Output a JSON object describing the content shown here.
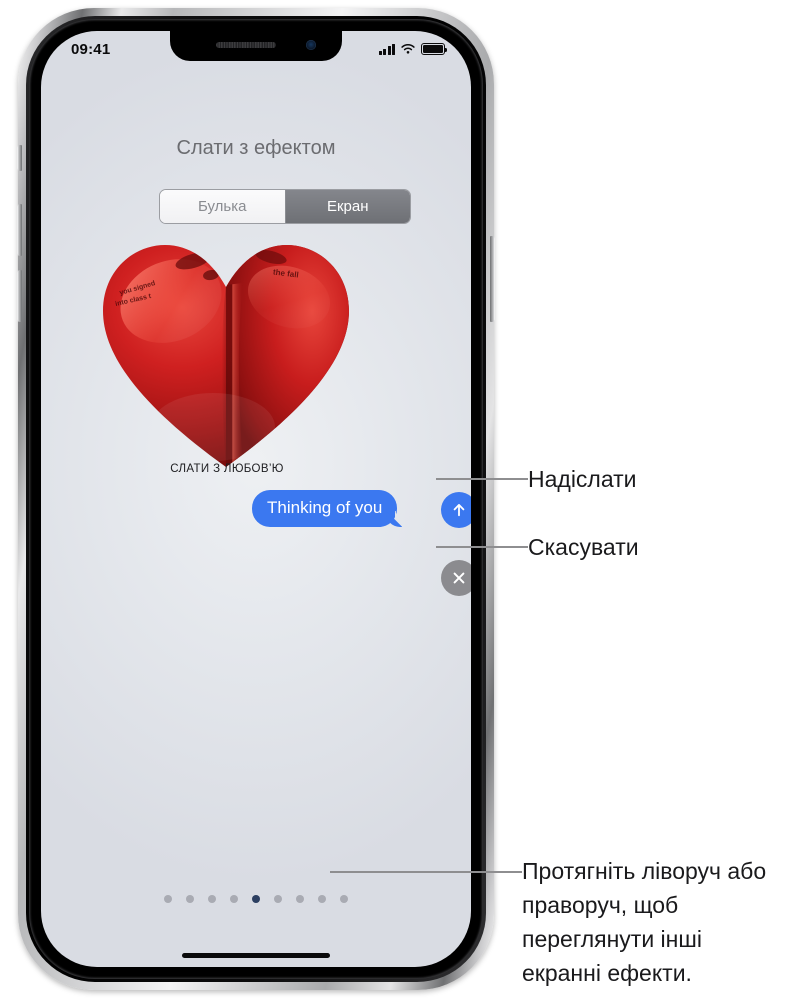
{
  "device": {
    "name": "iphone-x",
    "hardware_buttons": [
      "silent-switch",
      "volume-up",
      "volume-down",
      "side-button"
    ]
  },
  "statusbar": {
    "time": "09:41",
    "cellular_icon": "signal-bars-icon",
    "wifi_icon": "wifi-icon",
    "battery_icon": "battery-full-icon"
  },
  "screen": {
    "title": "Слати з ефектом",
    "segmented_control": {
      "options": [
        {
          "label": "Булька",
          "selected": false
        },
        {
          "label": "Екран",
          "selected": true
        }
      ]
    },
    "effect": {
      "name": "heart-effect",
      "caption": "СЛАТИ З ЛЮБОВ’Ю",
      "accent_color": "#c91f1f",
      "decor_text": [
        "you signed",
        "into class t",
        "the fall"
      ]
    },
    "message_bubble": {
      "text": "Thinking of you",
      "color": "#3b78f0",
      "text_color": "#ffffff"
    },
    "actions": [
      {
        "name": "send-button",
        "icon": "arrow-up-icon",
        "color": "#3b78f0"
      },
      {
        "name": "cancel-button",
        "icon": "close-x-icon",
        "color": "#8b8b8f"
      }
    ],
    "page_dots": {
      "count": 9,
      "active_index": 4,
      "active_color": "#2c3f61",
      "inactive_color": "#a9abb3"
    },
    "home_indicator": "home-indicator"
  },
  "callouts": {
    "send": "Надіслати",
    "cancel": "Скасувати",
    "swipe": "Протягніть ліворуч або праворуч, щоб переглянути інші екранні ефекти."
  }
}
